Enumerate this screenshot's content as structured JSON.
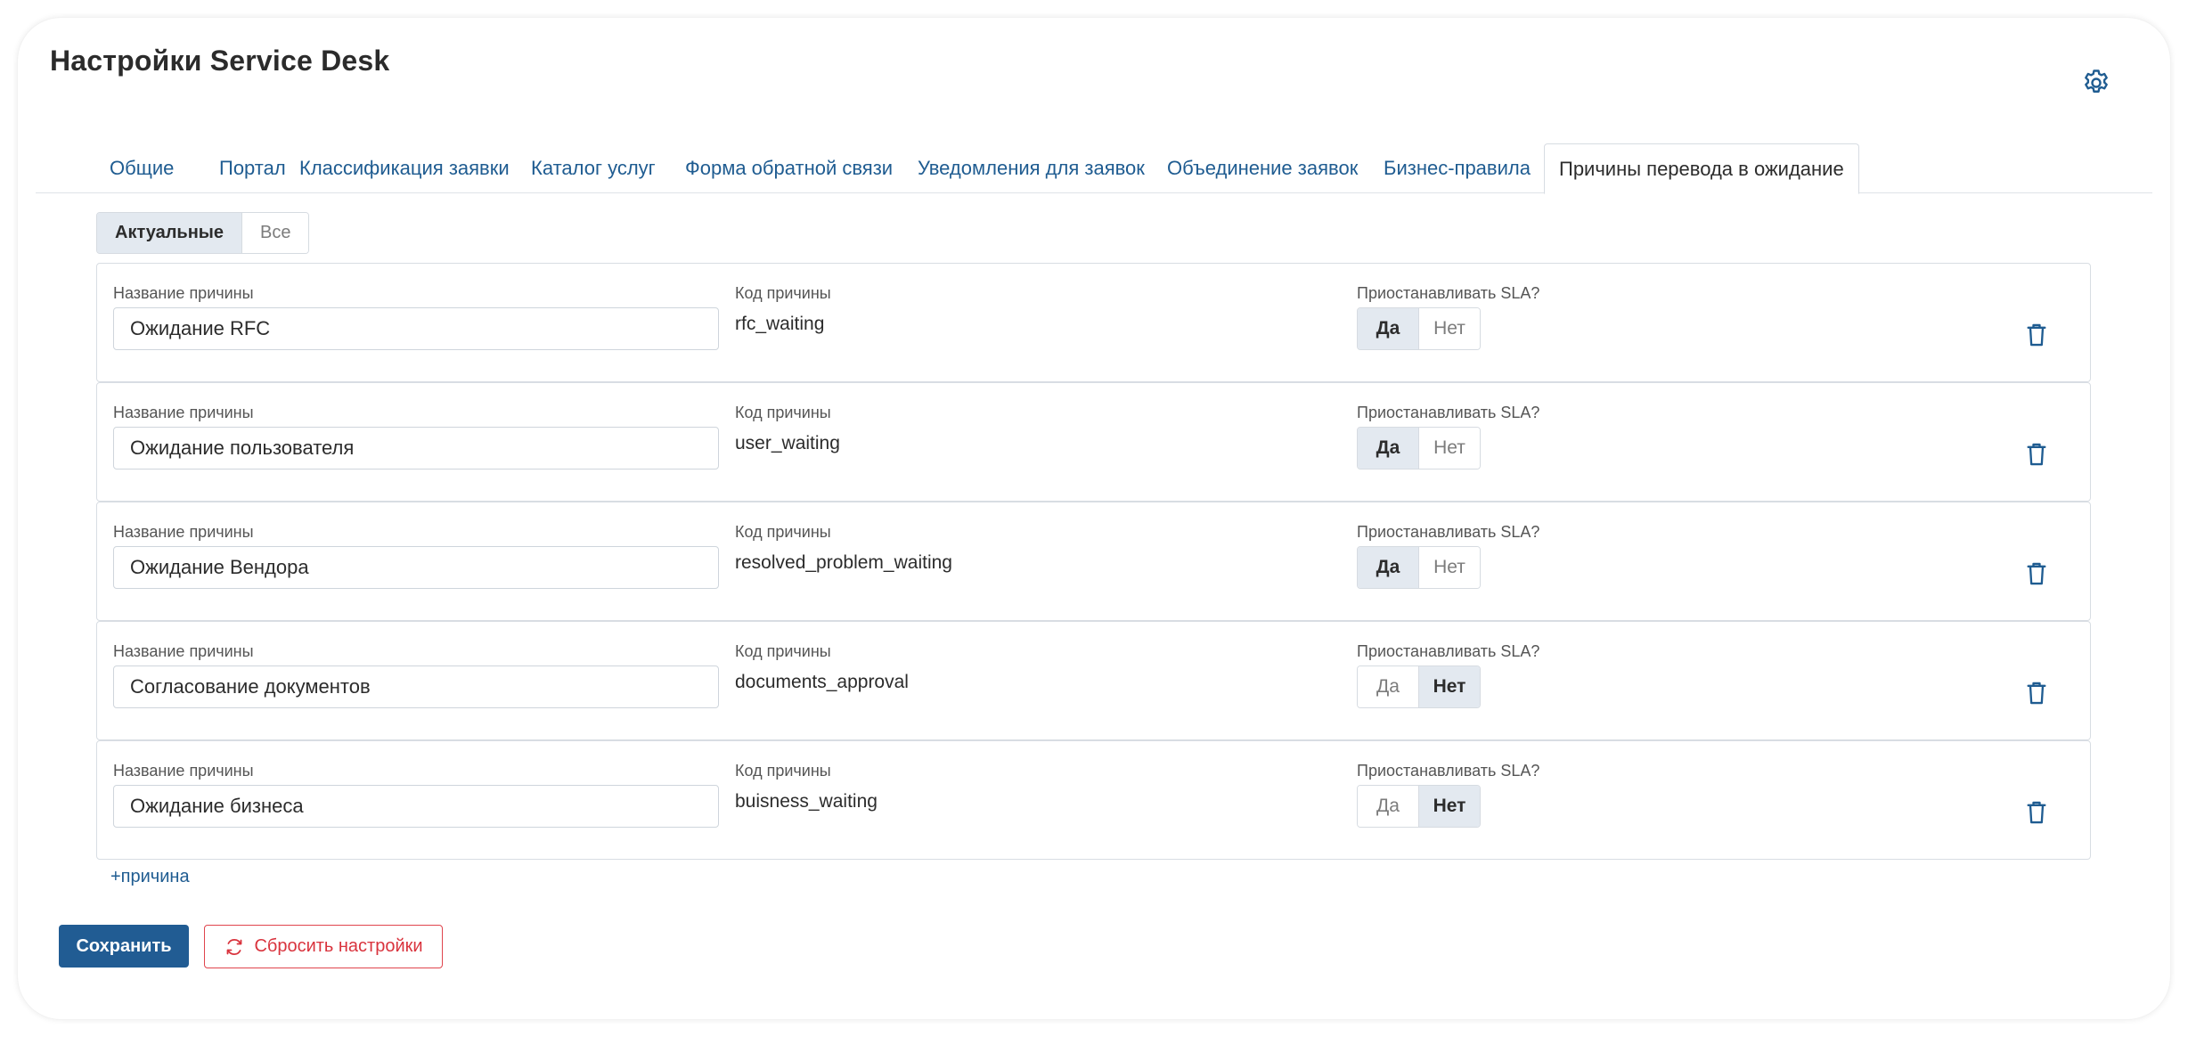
{
  "page_title": "Настройки Service Desk",
  "tabs": [
    {
      "label": "Общие",
      "active": false
    },
    {
      "label": "Портал",
      "active": false
    },
    {
      "label": "Классификация заявки",
      "active": false
    },
    {
      "label": "Каталог услуг",
      "active": false
    },
    {
      "label": "Форма обратной связи",
      "active": false
    },
    {
      "label": "Уведомления для заявок",
      "active": false
    },
    {
      "label": "Объединение заявок",
      "active": false
    },
    {
      "label": "Бизнес-правила",
      "active": false
    },
    {
      "label": "Причины перевода в ожидание",
      "active": true
    }
  ],
  "filter": {
    "current": "Актуальные",
    "all": "Все"
  },
  "labels": {
    "name": "Название причины",
    "code": "Код причины",
    "pause_sla": "Приостанавливать SLA?",
    "yes": "Да",
    "no": "Нет"
  },
  "reasons": [
    {
      "name": "Ожидание RFC",
      "code": "rfc_waiting",
      "pause_sla": true
    },
    {
      "name": "Ожидание пользователя",
      "code": "user_waiting",
      "pause_sla": true
    },
    {
      "name": "Ожидание Вендора",
      "code": "resolved_problem_waiting",
      "pause_sla": true
    },
    {
      "name": "Согласование документов",
      "code": "documents_approval",
      "pause_sla": false
    },
    {
      "name": "Ожидание бизнеса",
      "code": "buisness_waiting",
      "pause_sla": false
    }
  ],
  "add_reason_label": "+причина",
  "buttons": {
    "save": "Сохранить",
    "reset": "Сбросить настройки"
  },
  "colors": {
    "accent": "#215c93",
    "link": "#1f5c91",
    "danger": "#d9333d",
    "segment_active": "#e3e9f0"
  },
  "icons": {
    "settings": "gear-icon",
    "delete": "trash-icon",
    "reset": "refresh-icon"
  }
}
